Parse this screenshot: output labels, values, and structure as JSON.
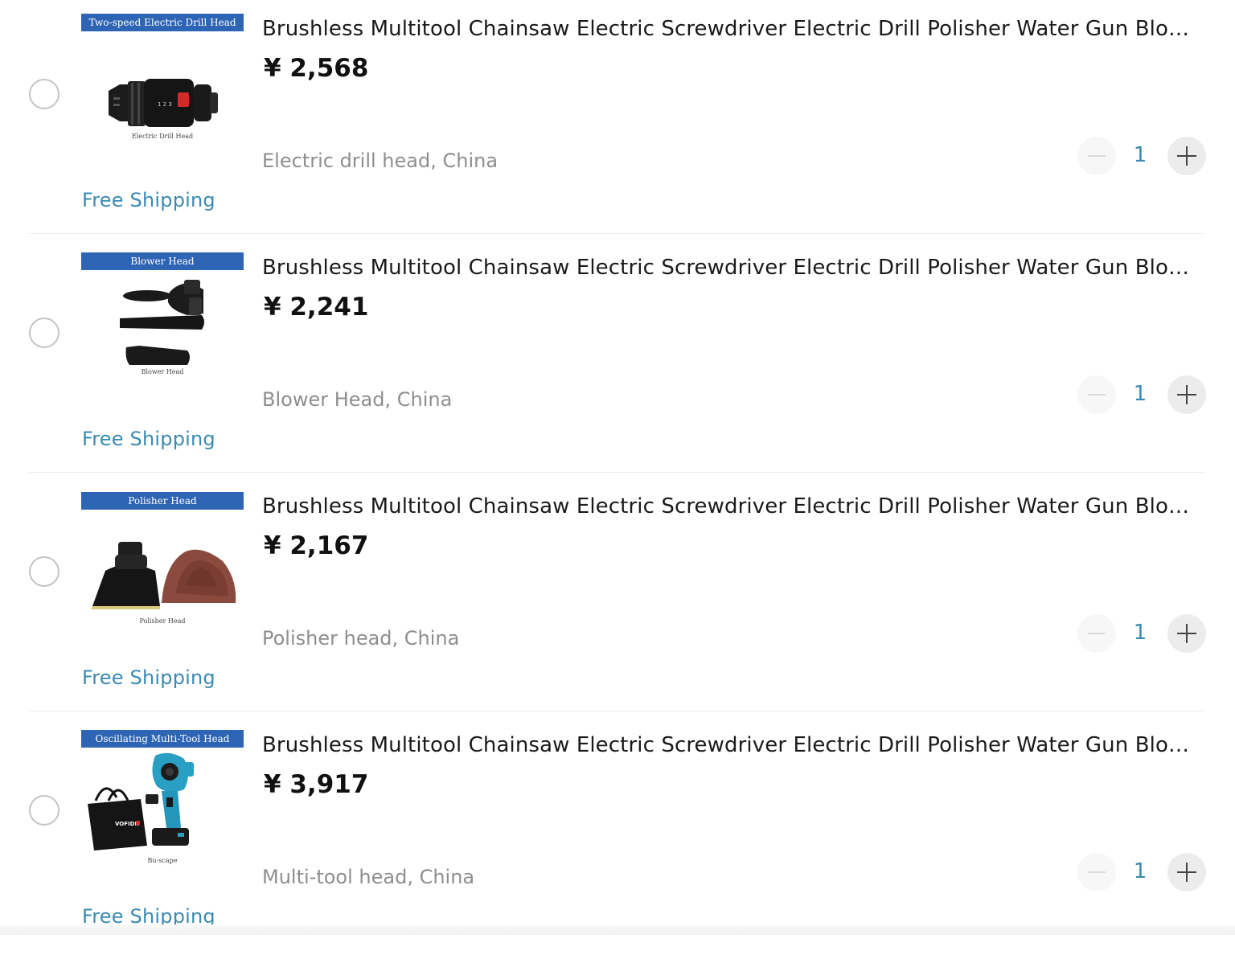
{
  "cart": {
    "items": [
      {
        "thumb_banner": "Two-speed Electric Drill Head",
        "thumb_caption": "Electric Drill Head",
        "title": "Brushless Multitool Chainsaw Electric Screwdriver Electric Drill Polisher Water Gun Blower Multi-tool Head",
        "price": "¥ 2,568",
        "sku": "Electric drill head, China",
        "quantity": "1",
        "shipping": "Free Shipping",
        "selected": false
      },
      {
        "thumb_banner": "Blower Head",
        "thumb_caption": "Blower Head",
        "title": "Brushless Multitool Chainsaw Electric Screwdriver Electric Drill Polisher Water Gun Blower Multi-tool Head",
        "price": "¥ 2,241",
        "sku": "Blower Head, China",
        "quantity": "1",
        "shipping": "Free Shipping",
        "selected": false
      },
      {
        "thumb_banner": "Polisher Head",
        "thumb_caption": "Polisher Head",
        "title": "Brushless Multitool Chainsaw Electric Screwdriver Electric Drill Polisher Water Gun Blower Multi-tool Head",
        "price": "¥ 2,167",
        "sku": "Polisher head, China",
        "quantity": "1",
        "shipping": "Free Shipping",
        "selected": false
      },
      {
        "thumb_banner": "Oscillating Multi-Tool Head",
        "thumb_caption": "Bu-scape",
        "title": "Brushless Multitool Chainsaw Electric Screwdriver Electric Drill Polisher Water Gun Blower Multi-tool Head",
        "price": "¥ 3,917",
        "sku": "Multi-tool head, China",
        "quantity": "1",
        "shipping": "Free Shipping",
        "selected": false
      }
    ],
    "bag_brand_text": "VOFIDR",
    "colors": {
      "accent_blue": "#3b8ab1",
      "banner_blue": "#2e64b4",
      "sku_gray": "#8e8e8e",
      "divider": "#ececec"
    }
  }
}
